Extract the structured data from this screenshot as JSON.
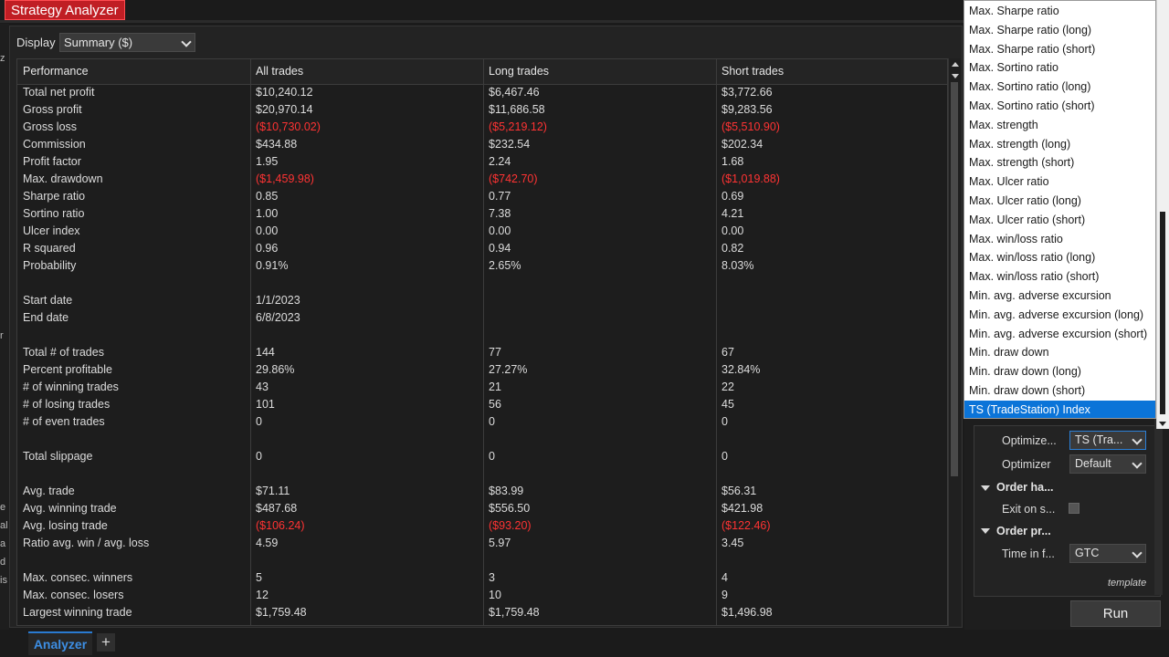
{
  "window": {
    "title": "Strategy Analyzer"
  },
  "display": {
    "label": "Display",
    "value": "Summary ($)"
  },
  "grid": {
    "columns": [
      "Performance",
      "All trades",
      "Long trades",
      "Short trades"
    ],
    "rows": [
      {
        "label": "Total net profit",
        "all": "$10,240.12",
        "long": "$6,467.46",
        "short": "$3,772.66"
      },
      {
        "label": "Gross profit",
        "all": "$20,970.14",
        "long": "$11,686.58",
        "short": "$9,283.56"
      },
      {
        "label": "Gross loss",
        "all": "($10,730.02)",
        "long": "($5,219.12)",
        "short": "($5,510.90)",
        "negative": true
      },
      {
        "label": "Commission",
        "all": "$434.88",
        "long": "$232.54",
        "short": "$202.34"
      },
      {
        "label": "Profit factor",
        "all": "1.95",
        "long": "2.24",
        "short": "1.68"
      },
      {
        "label": "Max. drawdown",
        "all": "($1,459.98)",
        "long": "($742.70)",
        "short": "($1,019.88)",
        "negative": true
      },
      {
        "label": "Sharpe ratio",
        "all": "0.85",
        "long": "0.77",
        "short": "0.69"
      },
      {
        "label": "Sortino ratio",
        "all": "1.00",
        "long": "7.38",
        "short": "4.21"
      },
      {
        "label": "Ulcer index",
        "all": "0.00",
        "long": "0.00",
        "short": "0.00"
      },
      {
        "label": "R squared",
        "all": "0.96",
        "long": "0.94",
        "short": "0.82"
      },
      {
        "label": "Probability",
        "all": "0.91%",
        "long": "2.65%",
        "short": "8.03%"
      },
      {
        "label": "",
        "all": "",
        "long": "",
        "short": ""
      },
      {
        "label": "Start date",
        "all": "1/1/2023",
        "long": "",
        "short": ""
      },
      {
        "label": "End date",
        "all": "6/8/2023",
        "long": "",
        "short": ""
      },
      {
        "label": "",
        "all": "",
        "long": "",
        "short": ""
      },
      {
        "label": "Total # of trades",
        "all": "144",
        "long": "77",
        "short": "67"
      },
      {
        "label": "Percent profitable",
        "all": "29.86%",
        "long": "27.27%",
        "short": "32.84%"
      },
      {
        "label": "# of winning trades",
        "all": "43",
        "long": "21",
        "short": "22"
      },
      {
        "label": "# of losing trades",
        "all": "101",
        "long": "56",
        "short": "45"
      },
      {
        "label": "# of even trades",
        "all": "0",
        "long": "0",
        "short": "0"
      },
      {
        "label": "",
        "all": "",
        "long": "",
        "short": ""
      },
      {
        "label": "Total slippage",
        "all": "0",
        "long": "0",
        "short": "0"
      },
      {
        "label": "",
        "all": "",
        "long": "",
        "short": ""
      },
      {
        "label": "Avg. trade",
        "all": "$71.11",
        "long": "$83.99",
        "short": "$56.31"
      },
      {
        "label": "Avg. winning trade",
        "all": "$487.68",
        "long": "$556.50",
        "short": "$421.98"
      },
      {
        "label": "Avg. losing trade",
        "all": "($106.24)",
        "long": "($93.20)",
        "short": "($122.46)",
        "negative": true
      },
      {
        "label": "Ratio avg. win / avg. loss",
        "all": "4.59",
        "long": "5.97",
        "short": "3.45"
      },
      {
        "label": "",
        "all": "",
        "long": "",
        "short": ""
      },
      {
        "label": "Max. consec. winners",
        "all": "5",
        "long": "3",
        "short": "4"
      },
      {
        "label": "Max. consec. losers",
        "all": "12",
        "long": "10",
        "short": "9"
      },
      {
        "label": "Largest winning trade",
        "all": "$1,759.48",
        "long": "$1,759.48",
        "short": "$1,496.98"
      }
    ]
  },
  "dropdown": {
    "items": [
      "Max. Sharpe ratio",
      "Max. Sharpe ratio (long)",
      "Max. Sharpe ratio (short)",
      "Max. Sortino ratio",
      "Max. Sortino ratio (long)",
      "Max. Sortino ratio (short)",
      "Max. strength",
      "Max. strength (long)",
      "Max. strength (short)",
      "Max. Ulcer ratio",
      "Max. Ulcer ratio (long)",
      "Max. Ulcer ratio (short)",
      "Max. win/loss ratio",
      "Max. win/loss ratio (long)",
      "Max. win/loss ratio (short)",
      "Min. avg. adverse excursion",
      "Min. avg. adverse excursion (long)",
      "Min. avg. adverse excursion (short)",
      "Min. draw down",
      "Min. draw down (long)",
      "Min. draw down (short)",
      "TS (TradeStation) Index"
    ],
    "selected_index": 21
  },
  "settings": {
    "optimize_label": "Optimize...",
    "optimize_value": "TS (Tra...",
    "optimizer_label": "Optimizer",
    "optimizer_value": "Default",
    "order_handling_section": "Order ha...",
    "exit_on_label": "Exit on s...",
    "order_properties_section": "Order pr...",
    "time_in_force_label": "Time in f...",
    "time_in_force_value": "GTC",
    "template_label": "template",
    "run_label": "Run"
  },
  "left_edge_glyphs": [
    "z",
    "r",
    "e",
    "al",
    "a",
    "d",
    "is"
  ],
  "bottom_tabs": {
    "analyzer": "Analyzer",
    "add": "+"
  }
}
